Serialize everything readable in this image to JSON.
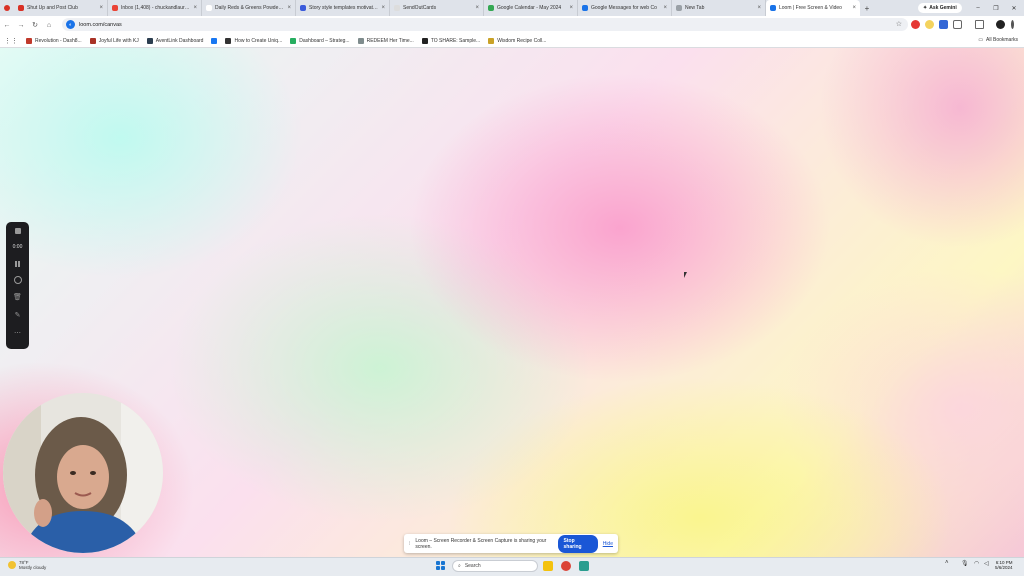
{
  "browser": {
    "tabs": [
      {
        "label": "Shut Up and Post Club",
        "icon_color": "#d93025"
      },
      {
        "label": "Inbox (1,408) - chuckandlaura@",
        "icon_color": "#ea4335"
      },
      {
        "label": "Daily Reds & Greens Powder Su",
        "icon_color": "#ffffff"
      },
      {
        "label": "Story style templates motivation",
        "icon_color": "#3b5bdb"
      },
      {
        "label": "SendOutCards",
        "icon_color": "#dddddd"
      },
      {
        "label": "Google Calendar - May 2024",
        "icon_color": "#34a853"
      },
      {
        "label": "Google Messages for web Co",
        "icon_color": "#1a73e8"
      },
      {
        "label": "New Tab",
        "icon_color": "#9aa0a6"
      },
      {
        "label": "Loom | Free Screen & Video",
        "icon_color": "#1a73e8",
        "active": true
      }
    ],
    "ask_gemini": "Ask Gemini",
    "url": "loom.com/canvas",
    "bookmarks": [
      {
        "label": "Revolution - Dash8...",
        "color": "#c0392b"
      },
      {
        "label": "Joyful Life with KJ",
        "color": "#a93226"
      },
      {
        "label": "AventLink Dashboard",
        "color": "#2c3e50"
      },
      {
        "label": "",
        "color": "#1877f2"
      },
      {
        "label": "How to Create Uniq...",
        "color": "#333333"
      },
      {
        "label": "Dashboard – Strateg...",
        "color": "#27ae60"
      },
      {
        "label": "REDEEM Her Time...",
        "color": "#7f8c8d"
      },
      {
        "label": "TO SHARE: Sample...",
        "color": "#222222"
      },
      {
        "label": "Wisdom Recipe Coll...",
        "color": "#c9a227"
      }
    ],
    "all_bookmarks": "All Bookmarks"
  },
  "recorder": {
    "timer": "0:00"
  },
  "share_bar": {
    "message": "Loom – Screen Recorder & Screen Capture is sharing your screen.",
    "stop_label": "Stop sharing",
    "hide_label": "Hide"
  },
  "taskbar": {
    "weather_temp": "78°F",
    "weather_desc": "Mostly cloudy",
    "search_placeholder": "Search",
    "time": "6:10 PM",
    "date": "5/6/2024"
  },
  "colors": {
    "accent": "#1a57d6",
    "control_panel": "#1d1d20"
  }
}
